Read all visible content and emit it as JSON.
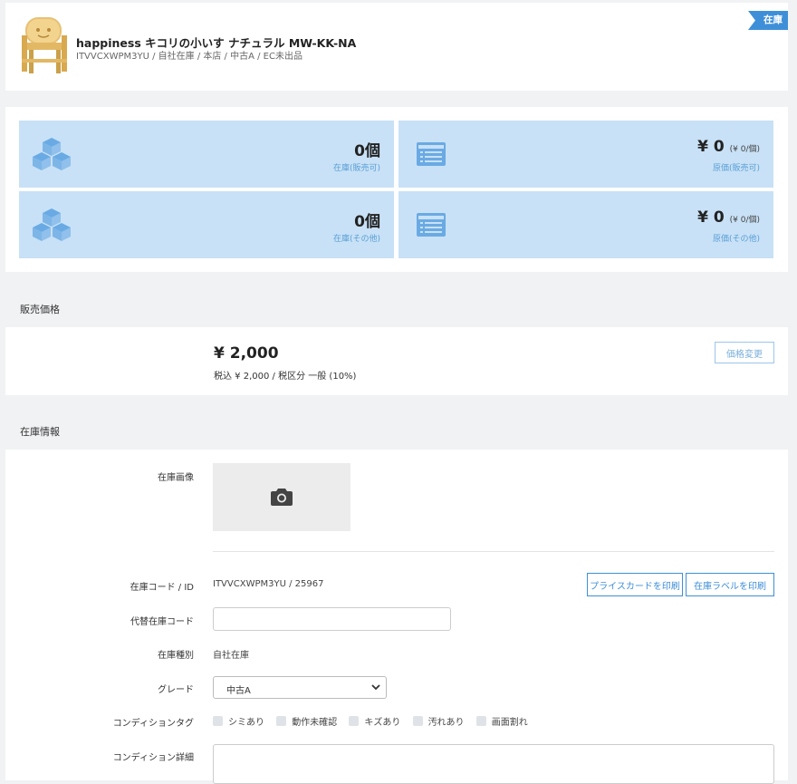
{
  "header": {
    "title": "happiness キコリの小いす ナチュラル MW-KK-NA",
    "subtitle": "ITVVCXWPM3YU / 自社在庫 / 本店 / 中古A / EC未出品",
    "status_badge": "在庫",
    "thumbnail_icon": "wooden-chair-image"
  },
  "summary": {
    "tiles": [
      {
        "value": "0個",
        "unit_note": "",
        "label": "在庫(販売可)",
        "icon": "boxes-icon"
      },
      {
        "value": "¥ 0",
        "unit_note": "(¥ 0/個)",
        "label": "原価(販売可)",
        "icon": "list-card-icon"
      },
      {
        "value": "0個",
        "unit_note": "",
        "label": "在庫(その他)",
        "icon": "boxes-icon"
      },
      {
        "value": "¥ 0",
        "unit_note": "(¥ 0/個)",
        "label": "原価(その他)",
        "icon": "list-card-icon"
      }
    ]
  },
  "price": {
    "heading": "販売価格",
    "amount": "¥ 2,000",
    "detail": "税込 ¥ 2,000 / 税区分 一般 (10%)",
    "change_button": "価格変更"
  },
  "stock": {
    "heading": "在庫情報",
    "image_label": "在庫画像",
    "code_label": "在庫コード / ID",
    "code_value": "ITVVCXWPM3YU / 25967",
    "print_price_card": "プライスカードを印刷",
    "print_stock_label": "在庫ラベルを印刷",
    "alt_code_label": "代替在庫コード",
    "alt_code_value": "",
    "type_label": "在庫種別",
    "type_value": "自社在庫",
    "grade_label": "グレード",
    "grade_value": "中古A",
    "condition_tags_label": "コンディションタグ",
    "condition_tags": [
      "シミあり",
      "動作未確認",
      "キズあり",
      "汚れあり",
      "画面割れ"
    ],
    "condition_detail_label": "コンディション詳細",
    "condition_detail_value": ""
  },
  "colors": {
    "accent": "#3f8fd8",
    "tile_bg": "#c8e1f6",
    "page_bg": "#f1f2f4"
  }
}
